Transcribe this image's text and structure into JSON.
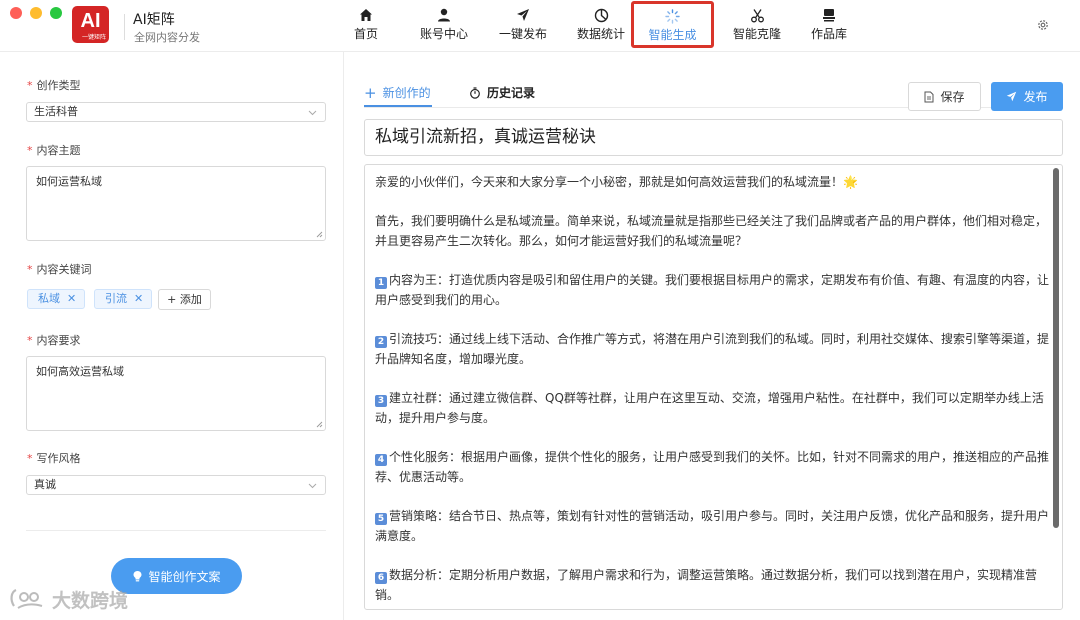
{
  "app": {
    "logo_text": "AI",
    "logo_sub": "一键矩阵",
    "title": "AI矩阵",
    "subtitle": "全网内容分发"
  },
  "nav": [
    {
      "label": "首页",
      "icon": "home-icon"
    },
    {
      "label": "账号中心",
      "icon": "user-icon"
    },
    {
      "label": "一键发布",
      "icon": "send-icon"
    },
    {
      "label": "数据统计",
      "icon": "pie-chart-icon"
    },
    {
      "label": "智能生成",
      "icon": "loading-spinner-icon",
      "active": true
    },
    {
      "label": "智能克隆",
      "icon": "scissors-icon"
    },
    {
      "label": "作品库",
      "icon": "library-icon"
    }
  ],
  "form": {
    "creation_type": {
      "label": "创作类型",
      "value": "生活科普"
    },
    "topic": {
      "label": "内容主题",
      "value": "如何运营私域"
    },
    "keywords": {
      "label": "内容关键词",
      "tags": [
        "私域",
        "引流"
      ],
      "add_label": "+ 添加"
    },
    "requirements": {
      "label": "内容要求",
      "value": "如何高效运营私域"
    },
    "style": {
      "label": "写作风格",
      "value": "真诚"
    },
    "generate_label": "智能创作文案"
  },
  "watermark": "大数跨境",
  "editor": {
    "tab_new": "新创作的",
    "tab_history": "历史记录",
    "save_label": "保存",
    "publish_label": "发布",
    "title": "私域引流新招，真诚运营秘诀",
    "paragraphs": [
      {
        "num": "",
        "text": "亲爱的小伙伴们，今天来和大家分享一个小秘密，那就是如何高效运营我们的私域流量！🌟"
      },
      {
        "num": "",
        "text": "首先，我们要明确什么是私域流量。简单来说，私域流量就是指那些已经关注了我们品牌或者产品的用户群体，他们相对稳定，并且更容易产生二次转化。那么，如何才能运营好我们的私域流量呢？"
      },
      {
        "num": "1",
        "text": "内容为王：打造优质内容是吸引和留住用户的关键。我们要根据目标用户的需求，定期发布有价值、有趣、有温度的内容，让用户感受到我们的用心。"
      },
      {
        "num": "2",
        "text": "引流技巧：通过线上线下活动、合作推广等方式，将潜在用户引流到我们的私域。同时，利用社交媒体、搜索引擎等渠道，提升品牌知名度，增加曝光度。"
      },
      {
        "num": "3",
        "text": "建立社群：通过建立微信群、QQ群等社群，让用户在这里互动、交流，增强用户粘性。在社群中，我们可以定期举办线上活动，提升用户参与度。"
      },
      {
        "num": "4",
        "text": "个性化服务：根据用户画像，提供个性化的服务，让用户感受到我们的关怀。比如，针对不同需求的用户，推送相应的产品推荐、优惠活动等。"
      },
      {
        "num": "5",
        "text": "营销策略：结合节日、热点等，策划有针对性的营销活动，吸引用户参与。同时，关注用户反馈，优化产品和服务，提升用户满意度。"
      },
      {
        "num": "6",
        "text": "数据分析：定期分析用户数据，了解用户需求和行为，调整运营策略。通过数据分析，我们可以找到潜在用户，实现精准营销。"
      }
    ]
  },
  "colors": {
    "accent": "#4a9cf0",
    "active_border": "#d9352a",
    "required": "#e54545"
  }
}
